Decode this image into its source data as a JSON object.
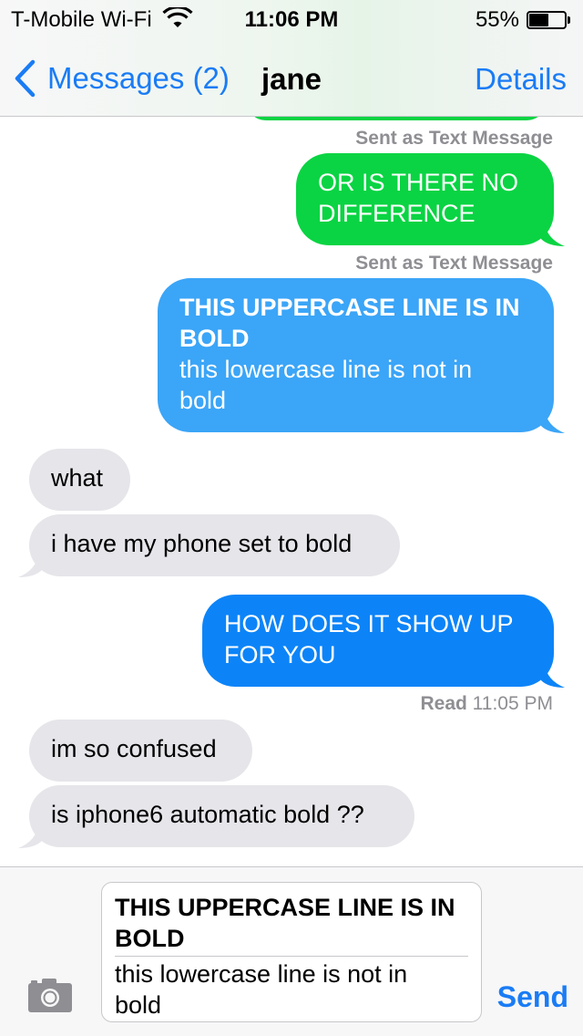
{
  "status_bar": {
    "carrier": "T-Mobile Wi-Fi",
    "time": "11:06 PM",
    "battery_percent": "55%",
    "battery_level": 0.55
  },
  "nav": {
    "back_label": "Messages (2)",
    "title": "jane",
    "details_label": "Details"
  },
  "conversation": {
    "sent_status_1": "Sent as Text Message",
    "msg_green": {
      "line1": "OR IS THERE NO",
      "line2": "DIFFERENCE"
    },
    "sent_status_2": "Sent as Text Message",
    "msg_bold": {
      "line1": "THIS UPPERCASE LINE IS IN",
      "line2": "BOLD",
      "line3": "this lowercase line is not in",
      "line4": "bold"
    },
    "msg_in_1": "what",
    "msg_in_2": "i have my phone set to bold",
    "msg_blue": {
      "line1": "HOW DOES IT SHOW UP",
      "line2": "FOR YOU"
    },
    "read_label": "Read",
    "read_time": "11:05 PM",
    "msg_in_3": "im so confused",
    "msg_in_4": "is iphone6 automatic bold ??"
  },
  "input": {
    "line1": "THIS UPPERCASE LINE IS IN",
    "line2": "BOLD",
    "line3": "this lowercase line is not in",
    "line4": "bold",
    "send_label": "Send"
  },
  "colors": {
    "accent": "#1a7cf5",
    "sms_green": "#0ad443",
    "imessage_blue": "#0c84f8",
    "incoming_gray": "#e5e5ea"
  },
  "icons": {
    "wifi": "wifi-icon",
    "battery": "battery-icon",
    "back": "chevron-left-icon",
    "camera": "camera-icon"
  }
}
